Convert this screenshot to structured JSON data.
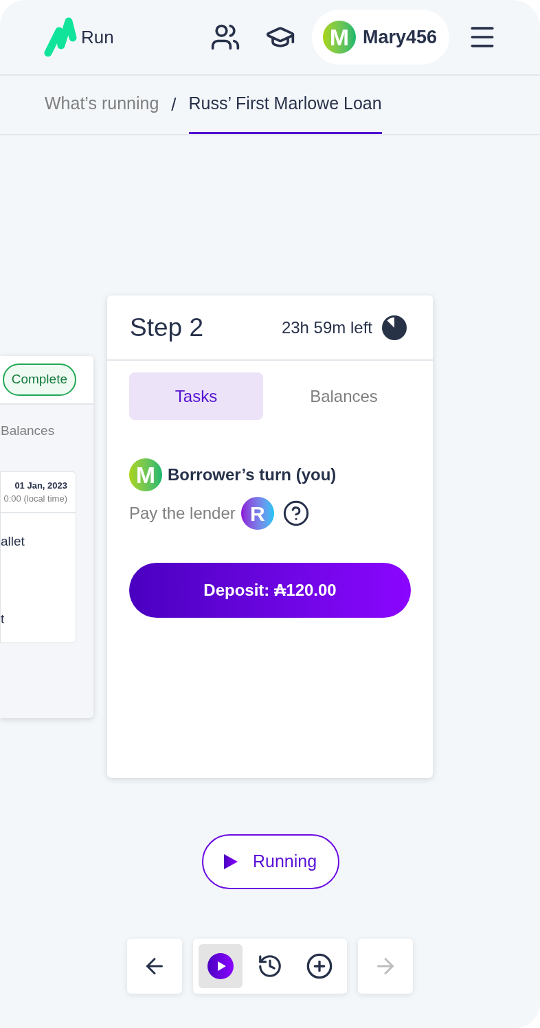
{
  "header": {
    "logo_text": "Run",
    "user": {
      "initial": "M",
      "name": "Mary456"
    }
  },
  "breadcrumb": {
    "separator": "/",
    "items": [
      {
        "label": "What’s running",
        "selected": false
      },
      {
        "label": "Russ’ First Marlowe Loan",
        "selected": true
      }
    ]
  },
  "previous_step": {
    "status": "Complete",
    "tab": "Balances",
    "date": "01 Jan, 2023",
    "time": "0:00 (local time)",
    "rows": [
      "allet",
      "t"
    ]
  },
  "step": {
    "title": "Step 2",
    "time_left": "23h 59m left",
    "tabs": [
      {
        "label": "Tasks",
        "selected": true
      },
      {
        "label": "Balances",
        "selected": false
      }
    ],
    "party": {
      "initial": "M",
      "turn": "Borrower’s turn (you)"
    },
    "task": {
      "text": "Pay the lender",
      "recipient_initial": "R"
    },
    "action": "Deposit: ₳120.00"
  },
  "status_button": "Running",
  "toolbar": {
    "back": {
      "disabled": false
    },
    "modes": [
      {
        "kind": "play",
        "selected": true
      },
      {
        "kind": "history",
        "selected": false
      },
      {
        "kind": "add",
        "selected": false
      }
    ],
    "forward": {
      "disabled": true
    }
  }
}
